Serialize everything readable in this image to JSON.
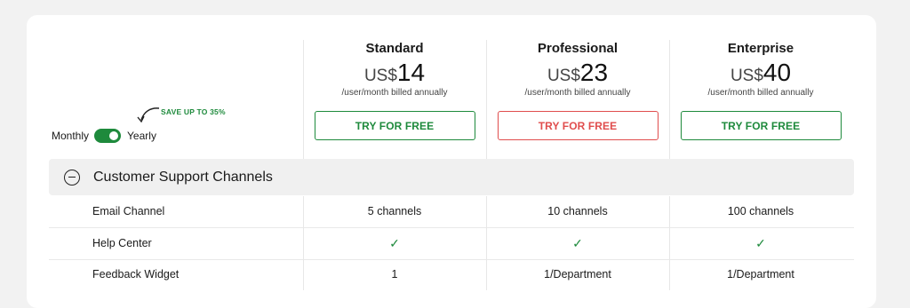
{
  "plans": [
    {
      "name": "Standard",
      "currency": "US$",
      "price": "14",
      "billing": "/user/month billed annually",
      "cta": "TRY FOR FREE",
      "style": "green"
    },
    {
      "name": "Professional",
      "currency": "US$",
      "price": "23",
      "billing": "/user/month billed annually",
      "cta": "TRY FOR FREE",
      "style": "red"
    },
    {
      "name": "Enterprise",
      "currency": "US$",
      "price": "40",
      "billing": "/user/month billed annually",
      "cta": "TRY FOR FREE",
      "style": "green"
    }
  ],
  "billing_toggle": {
    "monthly_label": "Monthly",
    "yearly_label": "Yearly",
    "selected": "Yearly",
    "save_note": "SAVE UP TO 35%"
  },
  "section": {
    "title": "Customer Support Channels",
    "state": "expanded"
  },
  "features": [
    {
      "name": "Email Channel",
      "values": [
        "5 channels",
        "10 channels",
        "100 channels"
      ]
    },
    {
      "name": "Help Center",
      "values": [
        "✓",
        "✓",
        "✓"
      ]
    },
    {
      "name": "Feedback Widget",
      "values": [
        "1",
        "1/Department",
        "1/Department"
      ]
    }
  ],
  "colors": {
    "accent": "#1e8a3c",
    "highlight": "#e04d4d",
    "section_bg": "#f0f0f0",
    "page_bg": "#f2f2f2"
  }
}
